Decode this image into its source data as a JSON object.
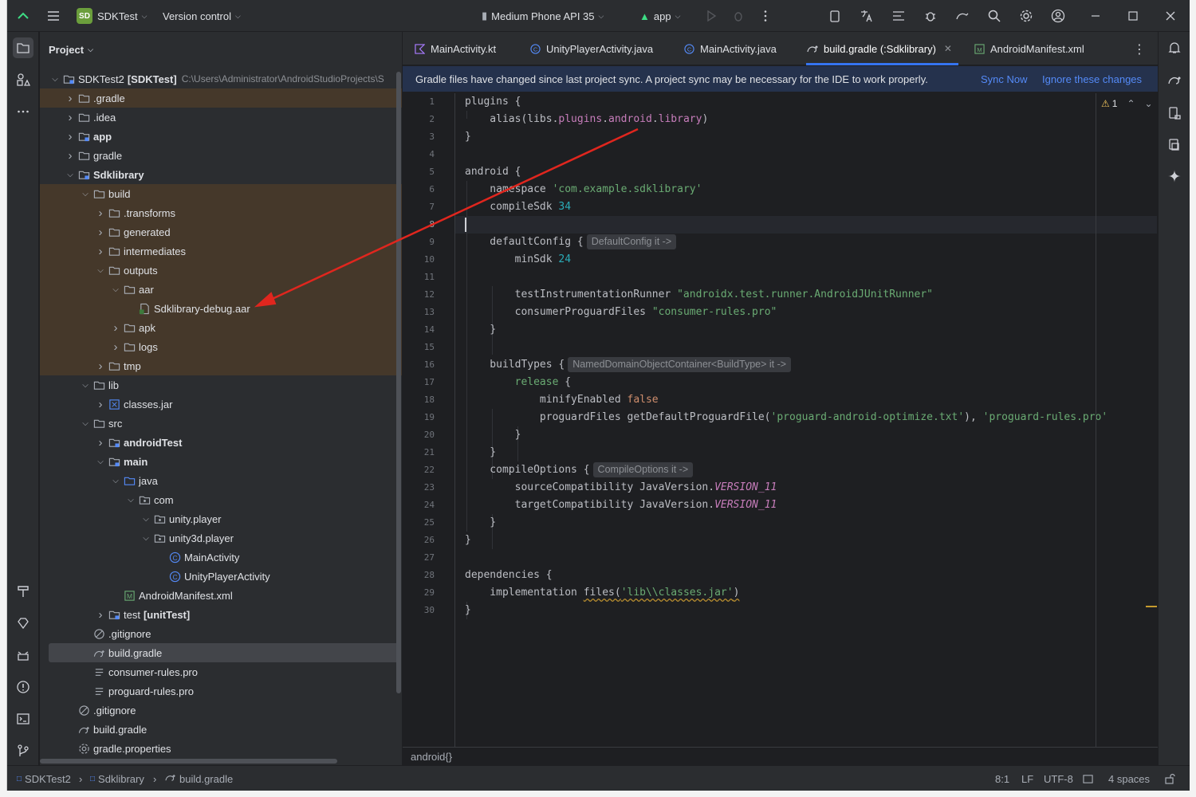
{
  "titlebar": {
    "project_badge": "SD",
    "project_name": "SDKTest",
    "vcs": "Version control",
    "device": "Medium Phone API 35",
    "run_config": "app"
  },
  "project_panel": {
    "title": "Project",
    "tree": [
      {
        "label": "SDKTest2",
        "bold_suffix": "[SDKTest]",
        "path": "C:\\Users\\Administrator\\AndroidStudioProjects\\S",
        "depth": 0,
        "expanded": true,
        "icon": "module-folder-icon",
        "bold": false
      },
      {
        "label": ".gradle",
        "depth": 1,
        "collapsed": true,
        "icon": "folder-icon",
        "excluded": true
      },
      {
        "label": ".idea",
        "depth": 1,
        "collapsed": true,
        "icon": "folder-icon"
      },
      {
        "label": "app",
        "depth": 1,
        "collapsed": true,
        "icon": "module-folder-icon",
        "bold": true
      },
      {
        "label": "gradle",
        "depth": 1,
        "collapsed": true,
        "icon": "folder-icon"
      },
      {
        "label": "Sdklibrary",
        "depth": 1,
        "expanded": true,
        "icon": "module-folder-icon",
        "bold": true
      },
      {
        "label": "build",
        "depth": 2,
        "expanded": true,
        "icon": "folder-icon",
        "excluded": true
      },
      {
        "label": ".transforms",
        "depth": 3,
        "collapsed": true,
        "icon": "folder-icon",
        "excluded": true
      },
      {
        "label": "generated",
        "depth": 3,
        "collapsed": true,
        "icon": "folder-icon",
        "excluded": true
      },
      {
        "label": "intermediates",
        "depth": 3,
        "collapsed": true,
        "icon": "folder-icon",
        "excluded": true
      },
      {
        "label": "outputs",
        "depth": 3,
        "expanded": true,
        "icon": "folder-icon",
        "excluded": true
      },
      {
        "label": "aar",
        "depth": 4,
        "expanded": true,
        "icon": "folder-icon",
        "excluded": true
      },
      {
        "label": "Sdklibrary-debug.aar",
        "depth": 5,
        "icon": "archive-file-icon",
        "excluded": true
      },
      {
        "label": "apk",
        "depth": 4,
        "collapsed": true,
        "icon": "folder-icon",
        "excluded": true
      },
      {
        "label": "logs",
        "depth": 4,
        "collapsed": true,
        "icon": "folder-icon",
        "excluded": true
      },
      {
        "label": "tmp",
        "depth": 3,
        "collapsed": true,
        "icon": "folder-icon",
        "excluded": true
      },
      {
        "label": "lib",
        "depth": 2,
        "expanded": true,
        "icon": "folder-icon"
      },
      {
        "label": "classes.jar",
        "depth": 3,
        "collapsed": true,
        "icon": "jar-icon"
      },
      {
        "label": "src",
        "depth": 2,
        "expanded": true,
        "icon": "folder-icon"
      },
      {
        "label": "androidTest",
        "depth": 3,
        "collapsed": true,
        "icon": "module-folder-icon",
        "bold": true
      },
      {
        "label": "main",
        "depth": 3,
        "expanded": true,
        "icon": "module-folder-icon",
        "bold": true
      },
      {
        "label": "java",
        "depth": 4,
        "expanded": true,
        "icon": "source-folder-icon"
      },
      {
        "label": "com",
        "depth": 5,
        "expanded": true,
        "icon": "package-icon"
      },
      {
        "label": "unity.player",
        "depth": 6,
        "expanded": true,
        "icon": "package-icon"
      },
      {
        "label": "unity3d.player",
        "depth": 6,
        "expanded": true,
        "icon": "package-icon"
      },
      {
        "label": "MainActivity",
        "depth": 7,
        "icon": "class-icon"
      },
      {
        "label": "UnityPlayerActivity",
        "depth": 7,
        "icon": "class-icon"
      },
      {
        "label": "AndroidManifest.xml",
        "depth": 4,
        "icon": "manifest-icon"
      },
      {
        "label": "test",
        "bold_suffix": "[unitTest]",
        "depth": 3,
        "collapsed": true,
        "icon": "module-folder-icon"
      },
      {
        "label": ".gitignore",
        "depth": 2,
        "icon": "gitignore-icon"
      },
      {
        "label": "build.gradle",
        "depth": 2,
        "icon": "gradle-icon",
        "selected": true
      },
      {
        "label": "consumer-rules.pro",
        "depth": 2,
        "icon": "text-file-icon"
      },
      {
        "label": "proguard-rules.pro",
        "depth": 2,
        "icon": "text-file-icon"
      },
      {
        "label": ".gitignore",
        "depth": 1,
        "icon": "gitignore-icon"
      },
      {
        "label": "build.gradle",
        "depth": 1,
        "icon": "gradle-icon"
      },
      {
        "label": "gradle.properties",
        "depth": 1,
        "icon": "settings-icon"
      }
    ]
  },
  "tabs": [
    {
      "label": "MainActivity.kt",
      "icon": "kotlin-icon"
    },
    {
      "label": "UnityPlayerActivity.java",
      "icon": "class-icon"
    },
    {
      "label": "MainActivity.java",
      "icon": "class-icon"
    },
    {
      "label": "build.gradle (:Sdklibrary)",
      "icon": "gradle-icon",
      "active": true
    },
    {
      "label": "AndroidManifest.xml",
      "icon": "manifest-icon"
    }
  ],
  "banner": {
    "message": "Gradle files have changed since last project sync. A project sync may be necessary for the IDE to work properly.",
    "sync_now": "Sync Now",
    "ignore": "Ignore these changes"
  },
  "editor": {
    "warning_count": "1",
    "bottom_breadcrumb": "android{}",
    "line_numbers": [
      "1",
      "2",
      "3",
      "4",
      "5",
      "6",
      "7",
      "8",
      "9",
      "10",
      "11",
      "12",
      "13",
      "14",
      "15",
      "16",
      "17",
      "18",
      "19",
      "20",
      "21",
      "22",
      "23",
      "24",
      "25",
      "26",
      "27",
      "28",
      "29",
      "30"
    ],
    "code": {
      "l1": "plugins {",
      "l2a": "    alias(libs.",
      "l2b": "plugins",
      "l2c": ".",
      "l2d": "android",
      "l2e": ".",
      "l2f": "library",
      "l2g": ")",
      "l3": "}",
      "l5": "android {",
      "l6a": "    namespace ",
      "l6b": "'com.example.sdklibrary'",
      "l7a": "    compileSdk ",
      "l7b": "34",
      "l9a": "    defaultConfig {",
      "l9hint": "DefaultConfig it ->",
      "l10a": "        minSdk ",
      "l10b": "24",
      "l12a": "        testInstrumentationRunner ",
      "l12b": "\"androidx.test.runner.AndroidJUnitRunner\"",
      "l13a": "        consumerProguardFiles ",
      "l13b": "\"consumer-rules.pro\"",
      "l14": "    }",
      "l16a": "    buildTypes {",
      "l16hint": "NamedDomainObjectContainer<BuildType> it ->",
      "l17a": "        ",
      "l17b": "release",
      "l17c": " {",
      "l18a": "            minifyEnabled ",
      "l18b": "false",
      "l19a": "            proguardFiles getDefaultProguardFile(",
      "l19b": "'proguard-android-optimize.txt'",
      "l19c": "), ",
      "l19d": "'proguard-rules.pro'",
      "l20": "        }",
      "l21": "    }",
      "l22a": "    compileOptions {",
      "l22hint": "CompileOptions it ->",
      "l23a": "        sourceCompatibility JavaVersion.",
      "l23b": "VERSION_11",
      "l24a": "        targetCompatibility JavaVersion.",
      "l24b": "VERSION_11",
      "l25": "    }",
      "l26": "}",
      "l28": "dependencies {",
      "l29a": "    implementation ",
      "l29b": "files(",
      "l29c": "'lib\\\\classes.jar'",
      "l29d": ")",
      "l30": "}"
    }
  },
  "statusbar": {
    "crumb1": "SDKTest2",
    "crumb2": "Sdklibrary",
    "crumb3": "build.gradle",
    "position": "8:1",
    "line_sep": "LF",
    "encoding": "UTF-8",
    "indent": "4 spaces"
  },
  "colors": {
    "accent": "#3574f0",
    "arrow": "#e0261e",
    "excluded_bg": "#45382a"
  }
}
